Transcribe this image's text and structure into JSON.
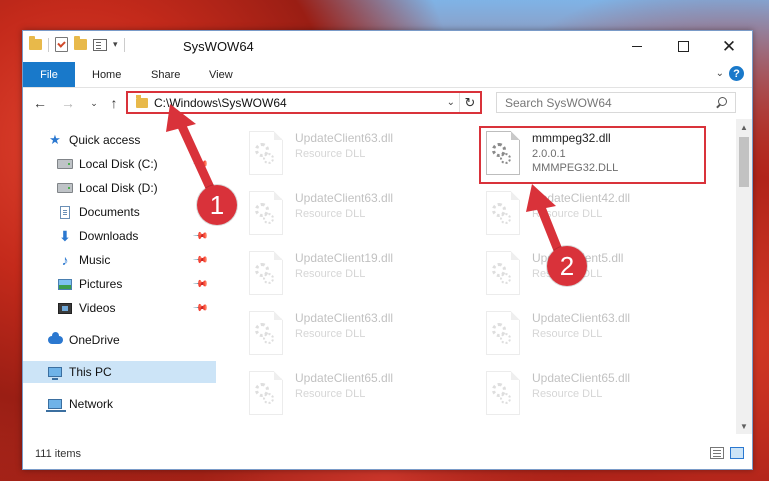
{
  "window": {
    "title": "SysWOW64"
  },
  "ribbon": {
    "file": "File",
    "home": "Home",
    "share": "Share",
    "view": "View",
    "help": "?"
  },
  "address": {
    "path": "C:\\Windows\\SysWOW64"
  },
  "search": {
    "placeholder": "Search SysWOW64"
  },
  "sidebar": {
    "items": [
      {
        "label": "Quick access"
      },
      {
        "label": "Local Disk (C:)"
      },
      {
        "label": "Local Disk (D:)"
      },
      {
        "label": "Documents"
      },
      {
        "label": "Downloads"
      },
      {
        "label": "Music"
      },
      {
        "label": "Pictures"
      },
      {
        "label": "Videos"
      },
      {
        "label": "OneDrive"
      },
      {
        "label": "This PC"
      },
      {
        "label": "Network"
      }
    ]
  },
  "files": [
    {
      "name": "UpdateClient63.dll",
      "sub": "Resource DLL"
    },
    {
      "name": "mmmpeg32.dll",
      "sub": "2.0.0.1",
      "sub2": "MMMPEG32.DLL"
    },
    {
      "name": "UpdateClient63.dll",
      "sub": "Resource DLL"
    },
    {
      "name": "UpdateClient42.dll",
      "sub": "Resource DLL"
    },
    {
      "name": "UpdateClient19.dll",
      "sub": "Resource DLL"
    },
    {
      "name": "UpdateClient5.dll",
      "sub": "Resource DLL"
    },
    {
      "name": "UpdateClient63.dll",
      "sub": "Resource DLL"
    },
    {
      "name": "UpdateClient63.dll",
      "sub": "Resource DLL"
    },
    {
      "name": "UpdateClient65.dll",
      "sub": "Resource DLL"
    },
    {
      "name": "UpdateClient65.dll",
      "sub": "Resource DLL"
    }
  ],
  "status": {
    "items": "111 items"
  },
  "annotations": {
    "step1": "1",
    "step2": "2"
  },
  "colors": {
    "accent": "#1979ca",
    "highlight": "#d9323a"
  }
}
